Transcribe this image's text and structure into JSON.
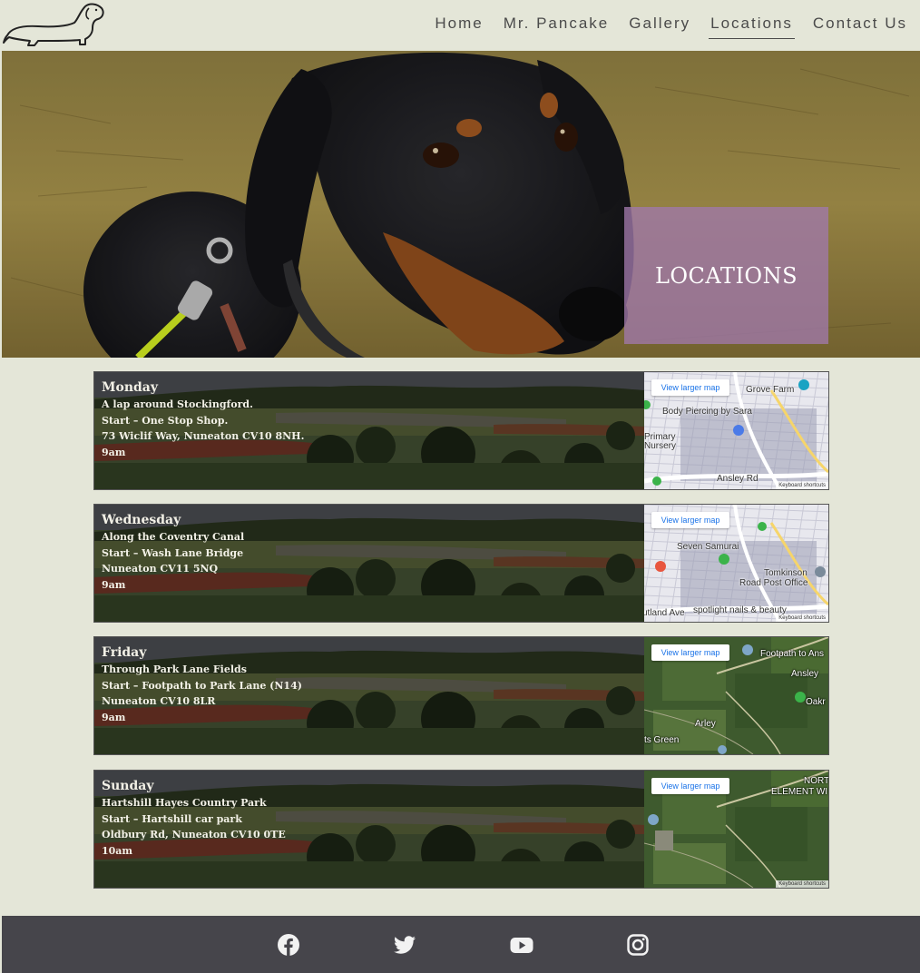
{
  "header": {
    "nav": [
      {
        "label": "Home"
      },
      {
        "label": "Mr. Pancake"
      },
      {
        "label": "Gallery"
      },
      {
        "label": "Locations"
      },
      {
        "label": "Contact Us"
      }
    ],
    "active_item": "Locations"
  },
  "hero": {
    "title": "LOCATIONS"
  },
  "locations": [
    {
      "day": "Monday",
      "lines": [
        "A lap around Stockingford.",
        "Start – One Stop Shop.",
        "73 Wiclif Way, Nuneaton CV10 8NH.",
        "9am"
      ],
      "map": {
        "button": "View larger map",
        "type": "street",
        "labels": [
          "Grove Farm",
          "Body Piercing by Sara",
          "Primary",
          "Nursery",
          "Ansley Rd"
        ],
        "footer": "Keyboard shortcuts"
      }
    },
    {
      "day": "Wednesday",
      "lines": [
        "Along the Coventry Canal",
        "Start – Wash Lane Bridge",
        "Nuneaton CV11 5NQ",
        "9am"
      ],
      "map": {
        "button": "View larger map",
        "type": "street",
        "labels": [
          "Seven Samurai",
          "Tomkinson",
          "Road Post Office",
          "spotlight nails & beauty",
          "utland Ave"
        ],
        "footer": "Keyboard shortcuts"
      }
    },
    {
      "day": "Friday",
      "lines": [
        "Through Park Lane Fields",
        "Start – Footpath to Park Lane (N14)",
        "Nuneaton CV10 8LR",
        "9am"
      ],
      "map": {
        "button": "View larger map",
        "type": "satellite",
        "labels": [
          "Footpath to Ans",
          "Ansley",
          "Oakr",
          "Arley",
          "ts Green"
        ],
        "footer": ""
      }
    },
    {
      "day": "Sunday",
      "lines": [
        "Hartshill Hayes Country Park",
        "Start – Hartshill car park",
        "Oldbury Rd, Nuneaton CV10 0TE",
        "10am"
      ],
      "map": {
        "button": "View larger map",
        "type": "satellite",
        "labels": [
          "NORT",
          "ELEMENT WI"
        ],
        "footer": "Keyboard shortcuts"
      }
    }
  ],
  "footer": {
    "social": [
      {
        "icon": "facebook-icon"
      },
      {
        "icon": "twitter-icon"
      },
      {
        "icon": "youtube-icon"
      },
      {
        "icon": "instagram-icon"
      }
    ]
  },
  "colors": {
    "page_bg": "#e4e6d8",
    "nav_text": "#4a4a4a",
    "hero_box": "#a078aa",
    "footer_bg": "#46454b",
    "map_link": "#1a73e8"
  }
}
